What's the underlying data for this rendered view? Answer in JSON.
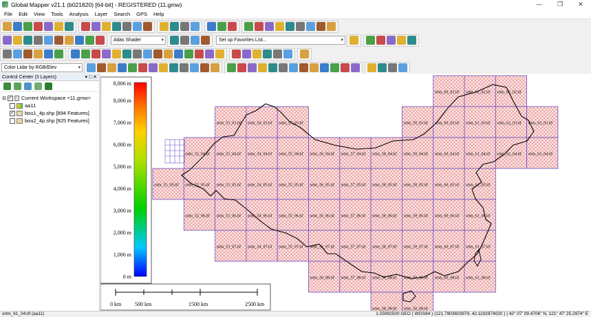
{
  "window": {
    "title": "Global Mapper v21.1 (b021820) [64-bit] - REGISTERED (11.gmw)",
    "minimize": "—",
    "maximize": "❐",
    "close": "✕"
  },
  "menu": [
    "File",
    "Edit",
    "View",
    "Tools",
    "Analysis",
    "Layer",
    "Search",
    "GPS",
    "Help"
  ],
  "toolbar": {
    "shader_select": "Atlas Shader",
    "favorites_select": "Set up Favorites List...",
    "lidar_color_select": "Color Lidar by RGB/Elev"
  },
  "control_center": {
    "title": "Control Center (3 Layers)",
    "header_buttons": "▾ □ ✕",
    "workspace": "Current Workspace <11.gmw>",
    "layers": [
      {
        "name": "aa11",
        "checked": false
      },
      {
        "name": "bou1_4p.shp [894 Features]",
        "checked": true
      },
      {
        "name": "bou2_4p.shp [925 Features]",
        "checked": false
      }
    ]
  },
  "legend": {
    "labels": [
      "8,806 m",
      "8,000 m",
      "7,000 m",
      "6,000 m",
      "5,000 m",
      "4,000 m",
      "3,000 m",
      "2,000 m",
      "1,000 m",
      "0 m"
    ]
  },
  "scalebar": {
    "labels": [
      "0 km",
      "500 km",
      "1500 km",
      "2500 km"
    ]
  },
  "tiles": {
    "rows": [
      {
        "y": 2,
        "cols": [
          60,
          61,
          62
        ]
      },
      {
        "y": 3,
        "cols": [
          53,
          54,
          55,
          59,
          60,
          61,
          62,
          63
        ]
      },
      {
        "y": 4,
        "cols": [
          52,
          53,
          54,
          55,
          56,
          57,
          58,
          59,
          60,
          61,
          62,
          63
        ]
      },
      {
        "y": 5,
        "cols": [
          51,
          52,
          53,
          54,
          55,
          56,
          57,
          58,
          59,
          60,
          61
        ]
      },
      {
        "y": 6,
        "cols": [
          52,
          53,
          54,
          55,
          56,
          57,
          58,
          59,
          60,
          61
        ]
      },
      {
        "y": 7,
        "cols": [
          53,
          54,
          55,
          56,
          57,
          58,
          59,
          60,
          61
        ]
      },
      {
        "y": 8,
        "cols": [
          56,
          57,
          58,
          59,
          60,
          61
        ]
      },
      {
        "y": 9,
        "cols": [
          58,
          59
        ]
      }
    ],
    "label_template": "srtm_{c}_0{r}.tif"
  },
  "status": {
    "left": "srtm_61_04.tif (aa11)",
    "right": "1:25992500  GEO ( WGS84 ) (121.7903603979, 42.1192974020 ) | 42° 07' 09.4706\" N, 121° 47' 25.2974\" E"
  },
  "colors": {
    "tile_border": "#6a4fc4",
    "tile_hatch": "#e07a7a",
    "accent": "#3399ff"
  }
}
